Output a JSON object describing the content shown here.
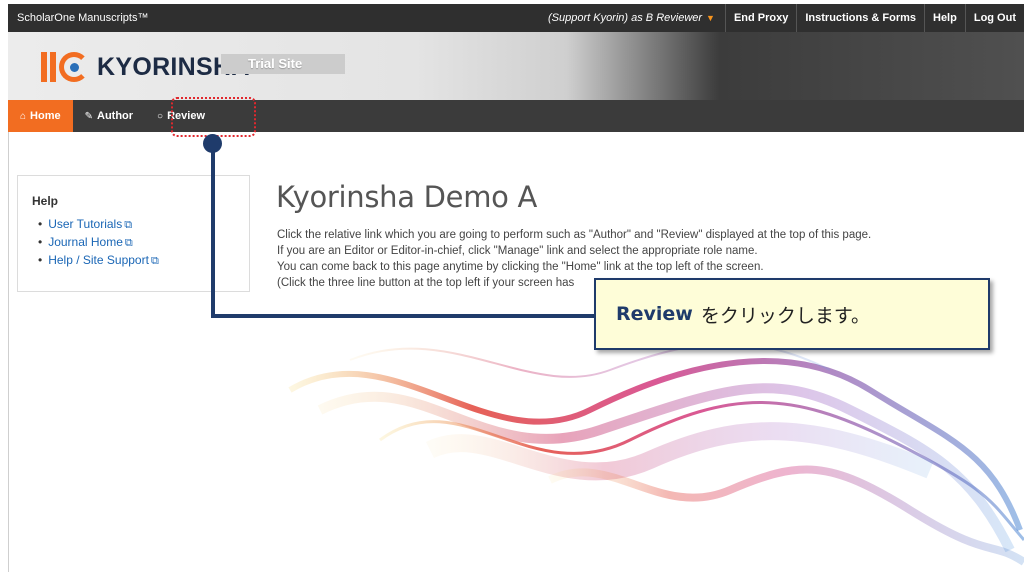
{
  "topbar": {
    "brand": "ScholarOne Manuscripts™",
    "proxy_label": "(Support Kyorin) as B Reviewer",
    "links": [
      "End Proxy",
      "Instructions & Forms",
      "Help",
      "Log Out"
    ]
  },
  "header": {
    "logo_text": "KYORINSHA",
    "site_label": "Trial Site"
  },
  "nav": {
    "tabs": [
      {
        "label": "Home",
        "icon": "home-icon"
      },
      {
        "label": "Author",
        "icon": "pencil-icon"
      },
      {
        "label": "Review",
        "icon": "comment-icon"
      }
    ]
  },
  "help": {
    "title": "Help",
    "links": [
      "User Tutorials",
      "Journal Home",
      "Help / Site Support"
    ]
  },
  "main": {
    "title": "Kyorinsha Demo A",
    "lines": [
      "Click the relative link which you are going to perform such as \"Author\" and \"Review\" displayed at the top of this page.",
      "If you are an Editor or Editor-in-chief, click \"Manage\" link and select the appropriate role name.",
      "You can come back to this page anytime by clicking the \"Home\" link at the top left of the screen.",
      "(Click the three line button at the top left if your screen has"
    ]
  },
  "callout": {
    "bold": "Review",
    "text": "をクリックします。"
  },
  "colors": {
    "accent": "#f26d21",
    "navy": "#1f3b6b",
    "link": "#1a66b5"
  }
}
